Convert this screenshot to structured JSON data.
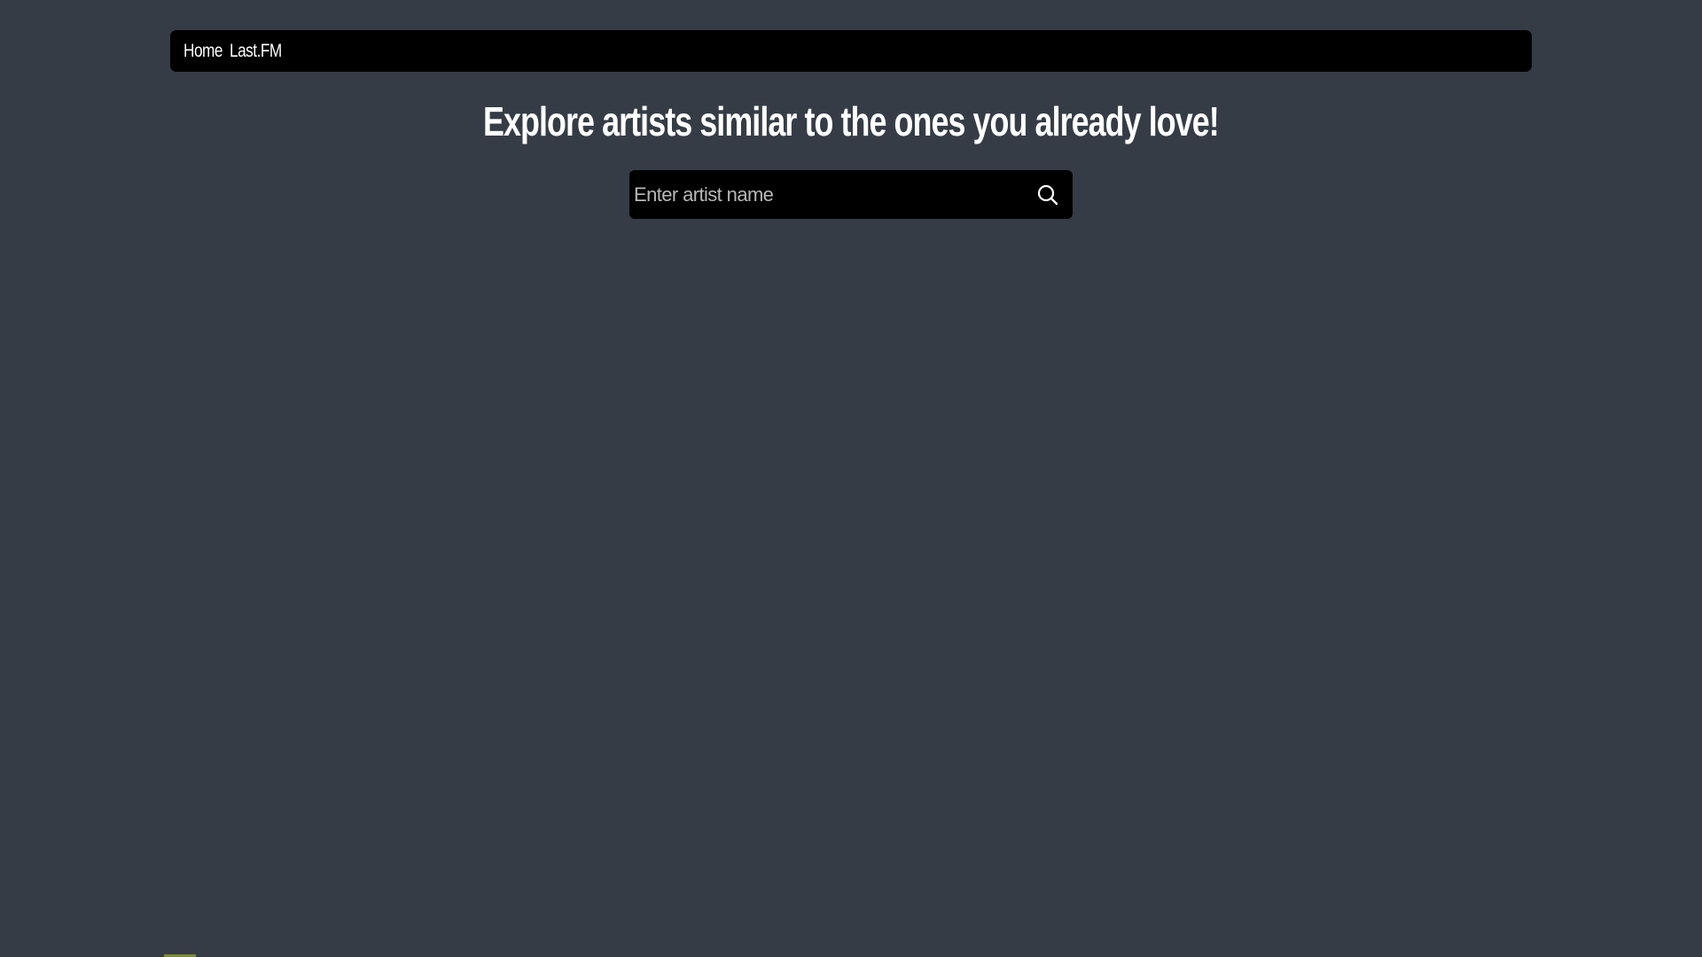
{
  "navbar": {
    "links": [
      {
        "label": "Home"
      },
      {
        "label": "Last.FM"
      }
    ]
  },
  "main": {
    "title": "Explore artists similar to the ones you already love!"
  },
  "search": {
    "placeholder": "Enter artist name",
    "value": "",
    "button_icon": "search-icon"
  },
  "colors": {
    "background": "#353c46",
    "bar": "#000000",
    "text": "#ffffff",
    "placeholder": "#b8b8b8"
  }
}
